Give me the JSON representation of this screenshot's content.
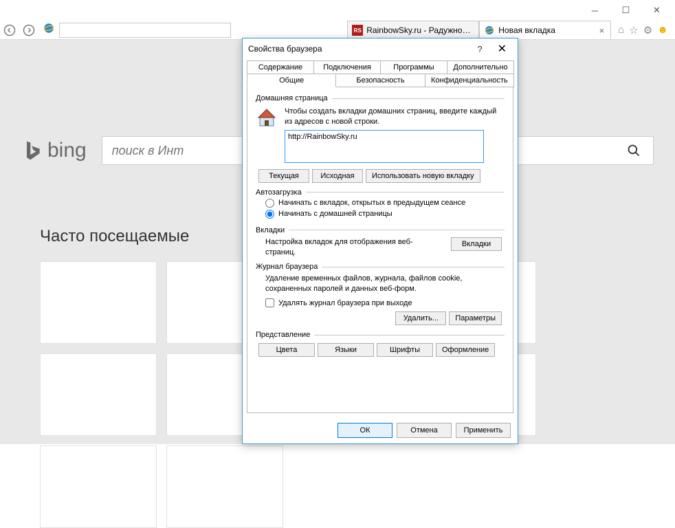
{
  "browser": {
    "tabs": [
      {
        "title": "RainbowSky.ru - Радужное Не…",
        "favicon_bg": "#b01e1e",
        "favicon_text": "RS"
      },
      {
        "title": "Новая вкладка",
        "favicon": "ie"
      }
    ]
  },
  "newtab": {
    "bing_label": "bing",
    "search_placeholder": "поиск в Инт",
    "frequent_label": "Часто посещаемые"
  },
  "dialog": {
    "title": "Свойства браузера",
    "tabs_row1": [
      "Содержание",
      "Подключения",
      "Программы",
      "Дополнительно"
    ],
    "tabs_row2": [
      "Общие",
      "Безопасность",
      "Конфиденциальность"
    ],
    "home": {
      "group": "Домашняя страница",
      "desc": "Чтобы создать вкладки домашних страниц, введите каждый из адресов с новой строки.",
      "value": "http://RainbowSky.ru",
      "btn_current": "Текущая",
      "btn_default": "Исходная",
      "btn_newtab": "Использовать новую вкладку"
    },
    "startup": {
      "group": "Автозагрузка",
      "opt_tabs": "Начинать с вкладок, открытых в предыдущем сеансе",
      "opt_home": "Начинать с домашней страницы"
    },
    "tabsgroup": {
      "group": "Вкладки",
      "desc": "Настройка вкладок для отображения веб-страниц.",
      "btn": "Вкладки"
    },
    "history": {
      "group": "Журнал браузера",
      "desc": "Удаление временных файлов, журнала, файлов cookie, сохраненных паролей и данных веб-форм.",
      "check": "Удалять журнал браузера при выходе",
      "btn_delete": "Удалить...",
      "btn_settings": "Параметры"
    },
    "appearance": {
      "group": "Представление",
      "btn_colors": "Цвета",
      "btn_lang": "Языки",
      "btn_fonts": "Шрифты",
      "btn_access": "Оформление"
    },
    "footer": {
      "ok": "ОК",
      "cancel": "Отмена",
      "apply": "Применить"
    }
  }
}
